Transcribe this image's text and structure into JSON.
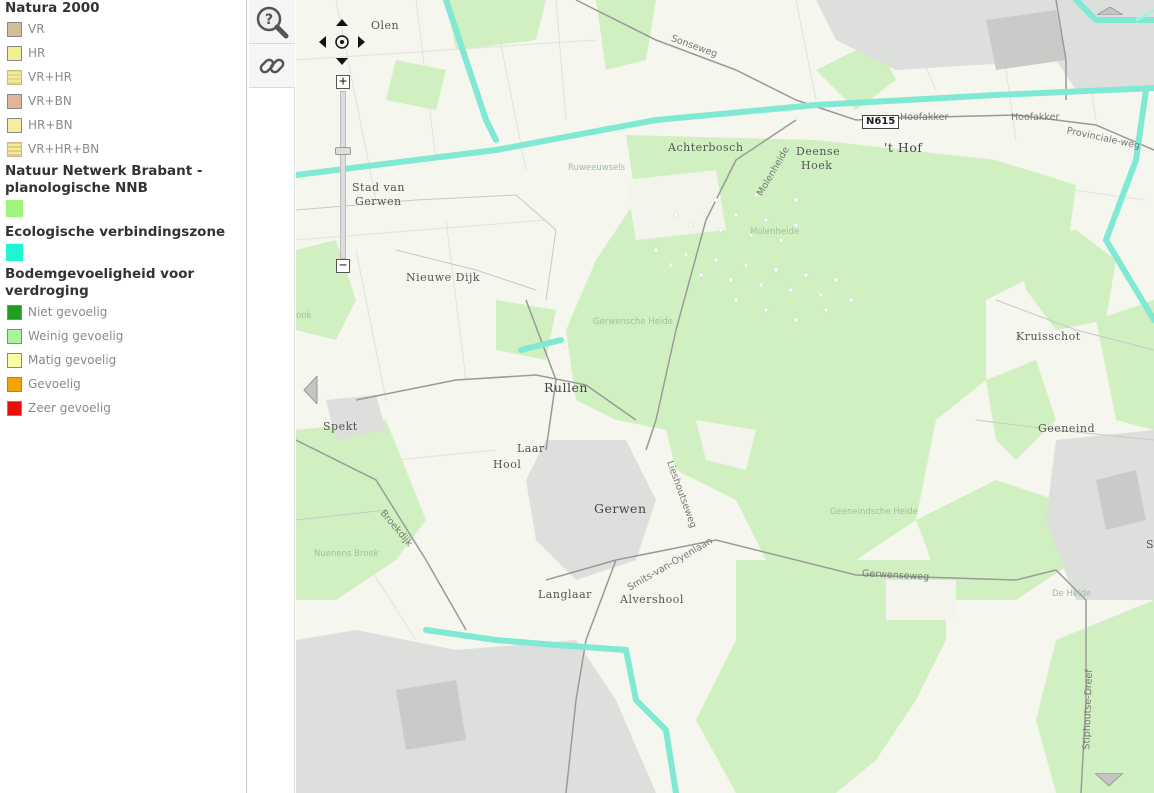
{
  "legend": {
    "natura": {
      "title": "Natura 2000",
      "items": [
        {
          "label": "VR",
          "color": "#d2bf98"
        },
        {
          "label": "HR",
          "color": "#f1ef8f"
        },
        {
          "label": "VR+HR",
          "color": "#e4d88f"
        },
        {
          "label": "VR+BN",
          "color": "#e2b59a"
        },
        {
          "label": "HR+BN",
          "color": "#f4ef9c"
        },
        {
          "label": "VR+HR+BN",
          "color": "#e8c694"
        }
      ]
    },
    "nnb": {
      "title": "Natuur Netwerk Brabant - planologische NNB",
      "color": "#9ef57c"
    },
    "eco": {
      "title": "Ecologische verbindingszone",
      "color": "#1ff5d2"
    },
    "bodem": {
      "title": "Bodemgevoeligheid voor verdroging",
      "items": [
        {
          "label": "Niet gevoelig",
          "color": "#1f9e1f"
        },
        {
          "label": "Weinig gevoelig",
          "color": "#a8f59a"
        },
        {
          "label": "Matig gevoelig",
          "color": "#fbfca6"
        },
        {
          "label": "Gevoelig",
          "color": "#f5a300"
        },
        {
          "label": "Zeer gevoelig",
          "color": "#ea0f0f"
        }
      ]
    }
  },
  "tools": {
    "identify_icon": "magnifier-question-icon",
    "link_icon": "chain-link-icon"
  },
  "map": {
    "places": {
      "olen": "Olen",
      "stad_van": "Stad van",
      "gerwen_stad": "Gerwen",
      "achterbosch": "Achterbosch",
      "deense": "Deense",
      "hoek": "Hoek",
      "t_hof": "'t Hof",
      "nieuwe_dijk": "Nieuwe Dijk",
      "kruisschot": "Kruisschot",
      "rullen": "Rullen",
      "spekt": "Spekt",
      "laar": "Laar",
      "hool": "Hool",
      "geeneind": "Geeneind",
      "gerwen": "Gerwen",
      "langlaar": "Langlaar",
      "alvershool": "Alvershool"
    },
    "roads": {
      "sonseweg": "Sonseweg",
      "hoofakker1": "Hoofakker",
      "hoofakker2": "Hoofakker",
      "provinciale": "Provinciale-weg",
      "molenheide": "Molenheide",
      "lieshoutseweg": "Lieshoutseweg",
      "smits": "Smits-van-Oyenlaan",
      "gerwenseweg": "Gerwenseweg",
      "broekdijk": "Broekdijk",
      "stiphoutse": "Stiphoutse-Dreef"
    },
    "areas": {
      "ruweeuwsels": "Ruweeuwsels",
      "molenheide_area": "Molenheide",
      "gerwensche_heide": "Gerwensche Heide",
      "geeneindsche_heide": "Geeneindsche Heide",
      "nuenens_broek": "Nuenens Broek",
      "de_heide": "De Heide",
      "fragment_left": "onk",
      "fragment_right": "S"
    },
    "shield": "N615"
  },
  "controls": {
    "zoom_in": "+",
    "zoom_out": "−"
  }
}
